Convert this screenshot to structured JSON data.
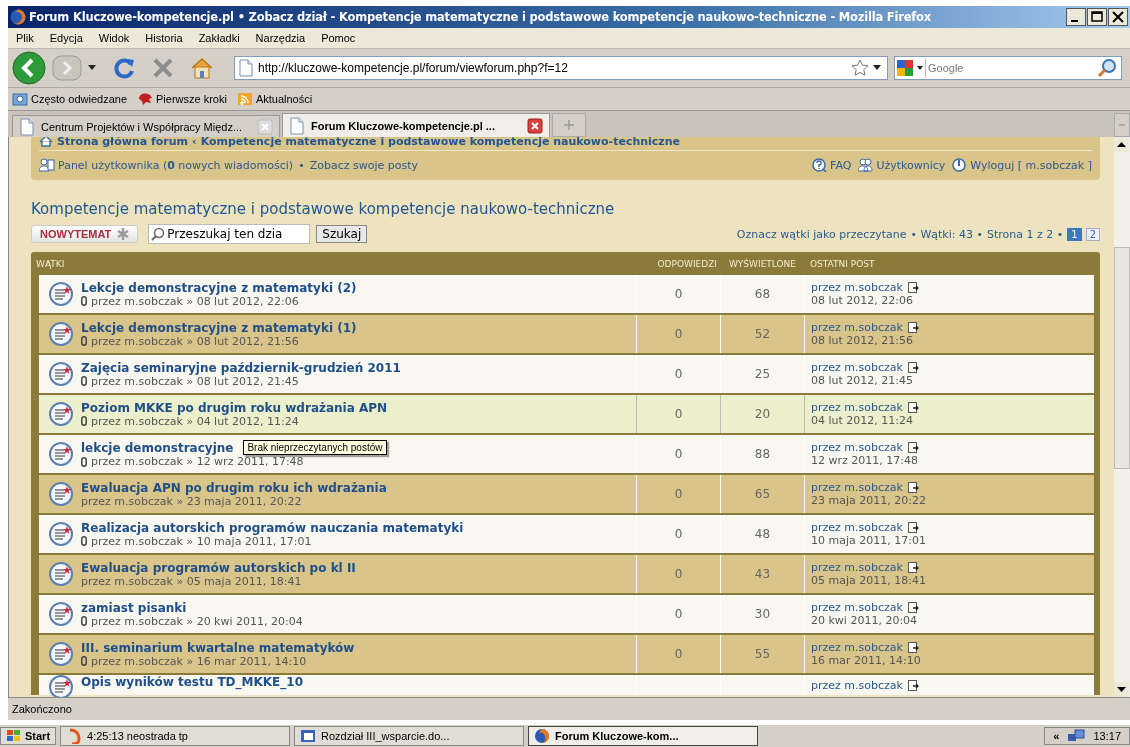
{
  "window": {
    "title": "Forum Kluczowe-kompetencje.pl • Zobacz dział - Kompetencje matematyczne i podstawowe kompetencje naukowo-techniczne - Mozilla Firefox"
  },
  "menu": [
    "Plik",
    "Edycja",
    "Widok",
    "Historia",
    "Zakładki",
    "Narzędzia",
    "Pomoc"
  ],
  "address": {
    "value": "http://kluczowe-kompetencje.pl/forum/viewforum.php?f=12"
  },
  "search": {
    "placeholder": "Google"
  },
  "bookmarks": [
    "Często odwiedzane",
    "Pierwsze kroki",
    "Aktualności"
  ],
  "tabs": [
    {
      "label": "Centrum Projektów i Współpracy Międz...",
      "selected": false
    },
    {
      "label": "Forum Kluczowe-kompetencje.pl ...",
      "selected": true
    }
  ],
  "forum": {
    "breadcrumb": [
      "Strona główna forum",
      "‹",
      "Kompetencje matematyczne i podstawowe kompetencje naukowo-techniczne"
    ],
    "user_panel": {
      "link": "Panel użytkownika (**0** nowych wiadomości)",
      "sep": "•",
      "posts": "Zobacz swoje posty"
    },
    "user_links": [
      "FAQ",
      "Użytkownicy",
      "Wyloguj [ m.sobczak ]"
    ],
    "heading": "Kompetencje matematyczne i podstawowe kompetencje naukowo-techniczne",
    "new_topic": "NOWYTEMAT",
    "search_field": {
      "value": "Przeszukaj ten dzia"
    },
    "search_button": "Szukaj",
    "pagination": {
      "mark_read": "Oznacz wątki jako przeczytane",
      "topics": "• Wątki: 43 •",
      "page": "Strona 1 z 2 •",
      "pages": [
        {
          "label": "1",
          "selected": true
        },
        {
          "label": "2",
          "selected": false
        }
      ]
    },
    "columns": [
      "WĄTKI",
      "ODPOWIEDZI",
      "WYŚWIETLONE",
      "OSTATNI POST"
    ],
    "rows": [
      {
        "title": "Lekcje demonstracyjne z matematyki (2)",
        "attachment": true,
        "meta": "przez m.sobczak » 08 lut 2012, 22:06",
        "replies": "0",
        "views": "68",
        "last_author": "przez m.sobczak",
        "last_date": "08 lut 2012, 22:06",
        "hovered": false
      },
      {
        "title": "Lekcje demonstracyjne z matematyki (1)",
        "attachment": true,
        "meta": "przez m.sobczak » 08 lut 2012, 21:56",
        "replies": "0",
        "views": "52",
        "last_author": "przez m.sobczak",
        "last_date": "08 lut 2012, 21:56",
        "hovered": false
      },
      {
        "title": "Zajęcia seminaryjne październik-grudzień 2011",
        "attachment": true,
        "meta": "przez m.sobczak » 08 lut 2012, 21:45",
        "replies": "0",
        "views": "25",
        "last_author": "przez m.sobczak",
        "last_date": "08 lut 2012, 21:45",
        "hovered": false
      },
      {
        "title": "Poziom MKKE po drugim roku wdrażania APN",
        "attachment": true,
        "meta": "przez m.sobczak » 04 lut 2012, 11:24",
        "replies": "0",
        "views": "20",
        "last_author": "przez m.sobczak",
        "last_date": "04 lut 2012, 11:24",
        "hovered": true
      },
      {
        "title": "lekcje demonstracyjne",
        "attachment": true,
        "meta": "przez m.sobczak » 12 wrz 2011, 17:48",
        "replies": "0",
        "views": "88",
        "last_author": "przez m.sobczak",
        "last_date": "12 wrz 2011, 17:48",
        "hovered": false,
        "tooltip": "Brak nieprzeczytanych postów"
      },
      {
        "title": "Ewaluacja APN po drugim roku ich wdrażania",
        "attachment": false,
        "meta": "przez m.sobczak » 23 maja 2011, 20:22",
        "replies": "0",
        "views": "65",
        "last_author": "przez m.sobczak",
        "last_date": "23 maja 2011, 20:22",
        "hovered": false
      },
      {
        "title": "Realizacja autorskich programów nauczania matematyki",
        "attachment": true,
        "meta": "przez m.sobczak » 10 maja 2011, 17:01",
        "replies": "0",
        "views": "48",
        "last_author": "przez m.sobczak",
        "last_date": "10 maja 2011, 17:01",
        "hovered": false
      },
      {
        "title": "Ewaluacja programów autorskich po kl II",
        "attachment": false,
        "meta": "przez m.sobczak » 05 maja 2011, 18:41",
        "replies": "0",
        "views": "43",
        "last_author": "przez m.sobczak",
        "last_date": "05 maja 2011, 18:41",
        "hovered": false
      },
      {
        "title": "zamiast pisanki",
        "attachment": true,
        "meta": "przez m.sobczak » 20 kwi 2011, 20:04",
        "replies": "0",
        "views": "30",
        "last_author": "przez m.sobczak",
        "last_date": "20 kwi 2011, 20:04",
        "hovered": false
      },
      {
        "title": "III. seminarium kwartalne matematyków",
        "attachment": true,
        "meta": "przez m.sobczak » 16 mar 2011, 14:10",
        "replies": "0",
        "views": "55",
        "last_author": "przez m.sobczak",
        "last_date": "16 mar 2011, 14:10",
        "hovered": false
      },
      {
        "title": "Opis wyników testu TD_MKKE_10",
        "last_author": "przez m.sobczak",
        "hovered": false
      }
    ]
  },
  "status_bar": "Zakończono",
  "taskbar": {
    "start": "Start",
    "items": [
      {
        "label": "4:25:13 neostrada tp",
        "selected": false
      },
      {
        "label": "Rozdział III_wsparcie.do...",
        "selected": false
      },
      {
        "label": "Forum Kluczowe-kom...",
        "selected": true
      }
    ],
    "tray_toggle": "«",
    "clock": "13:17"
  }
}
